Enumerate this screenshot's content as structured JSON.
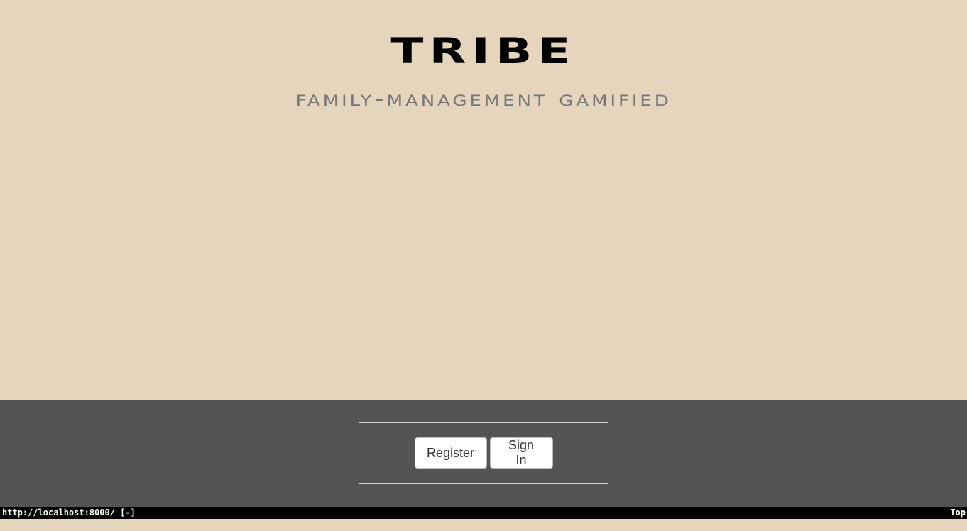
{
  "hero": {
    "title": "Tribe",
    "tagline": "Family-Management Gamified"
  },
  "footer": {
    "register_label": "Register",
    "signin_label": "Sign In"
  },
  "statusbar": {
    "url": "http://localhost:8000/ [-]",
    "position": "Top"
  },
  "colors": {
    "hero_background": "#e5d5bd",
    "footer_background": "#545454",
    "title": "#000000",
    "tagline": "#777777",
    "statusbar_background": "#000000"
  }
}
